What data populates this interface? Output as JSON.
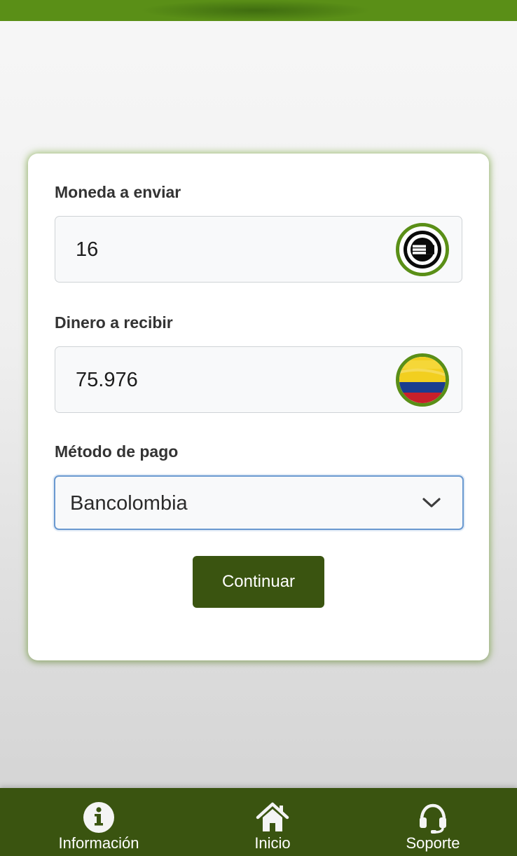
{
  "header": {
    "accent": "#5a8f17"
  },
  "form": {
    "send": {
      "label": "Moneda a enviar",
      "value": "16",
      "icon": "crypto-coin-icon"
    },
    "receive": {
      "label": "Dinero a recibir",
      "value": "75.976",
      "icon": "colombia-flag-icon"
    },
    "payment": {
      "label": "Método de pago",
      "selected": "Bancolombia"
    },
    "submit_label": "Continuar"
  },
  "nav": {
    "items": [
      {
        "label": "Información",
        "icon": "info-icon"
      },
      {
        "label": "Inicio",
        "icon": "home-icon"
      },
      {
        "label": "Soporte",
        "icon": "headset-icon"
      }
    ]
  },
  "colors": {
    "brand_dark": "#3a5410",
    "brand_light": "#5a8f17",
    "focus_border": "#6a99d0"
  }
}
